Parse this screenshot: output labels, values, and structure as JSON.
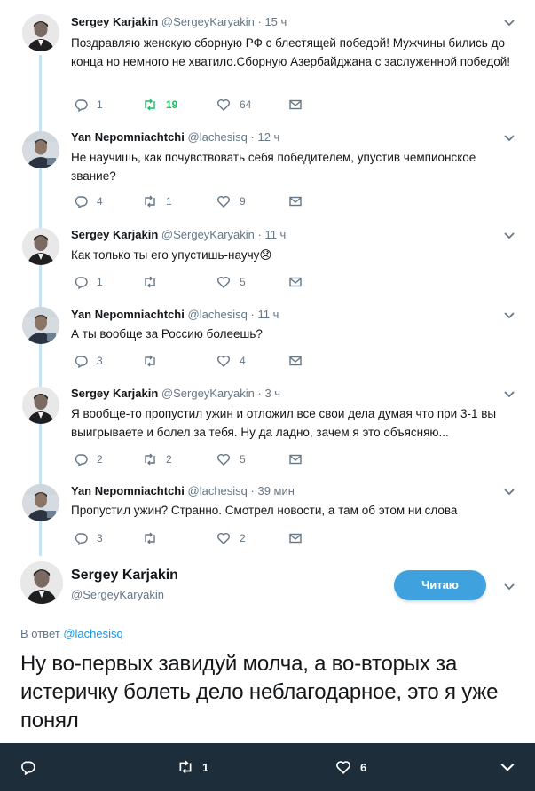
{
  "tweets": [
    {
      "name": "Sergey Karjakin",
      "handle": "@SergeyKaryakin",
      "time": "15 ч",
      "text": "Поздравляю женскую сборную РФ с блестящей победой! Мужчины бились до конца но немного не хватило.Сборную Азербайджана с заслуженной победой!",
      "replies": "1",
      "retweets": "19",
      "likes": "64",
      "retweeted": true
    },
    {
      "name": "Yan Nepomniachtchi",
      "handle": "@lachesisq",
      "time": "12 ч",
      "text": "Не научишь, как почувствовать себя победителем, упустив чемпионское звание?",
      "replies": "4",
      "retweets": "1",
      "likes": "9",
      "retweeted": false
    },
    {
      "name": "Sergey Karjakin",
      "handle": "@SergeyKaryakin",
      "time": "11 ч",
      "text": "Как только ты его упустишь-научу😞",
      "replies": "1",
      "retweets": "",
      "likes": "5",
      "retweeted": false
    },
    {
      "name": "Yan Nepomniachtchi",
      "handle": "@lachesisq",
      "time": "11 ч",
      "text": "А ты вообще за Россию болеешь?",
      "replies": "3",
      "retweets": "",
      "likes": "4",
      "retweeted": false
    },
    {
      "name": "Sergey Karjakin",
      "handle": "@SergeyKaryakin",
      "time": "3 ч",
      "text": "Я вообще-то пропустил ужин и отложил все свои дела думая что при 3-1 вы выигрываете и болел за тебя. Ну да ладно, зачем я это объясняю...",
      "replies": "2",
      "retweets": "2",
      "likes": "5",
      "retweeted": false
    },
    {
      "name": "Yan Nepomniachtchi",
      "handle": "@lachesisq",
      "time": "39 мин",
      "text": "Пропустил ужин? Странно. Смотрел новости, а там об этом ни слова",
      "replies": "3",
      "retweets": "",
      "likes": "2",
      "retweeted": false
    }
  ],
  "main_tweet": {
    "name": "Sergey Karjakin",
    "handle": "@SergeyKaryakin",
    "follow_label": "Читаю",
    "reply_prefix": "В ответ",
    "reply_to": "@lachesisq",
    "text": "Ну во-первых завидуй молча, а во-вторых за истеричку болеть дело неблагодарное, это я уже понял",
    "replies": "",
    "retweets": "1",
    "likes": "6"
  },
  "colors": {
    "accent": "#1b95e0",
    "retweet_active": "#17bf63",
    "follow_button": "#3fa1dd",
    "bottom_bar": "#1e2d3a"
  }
}
